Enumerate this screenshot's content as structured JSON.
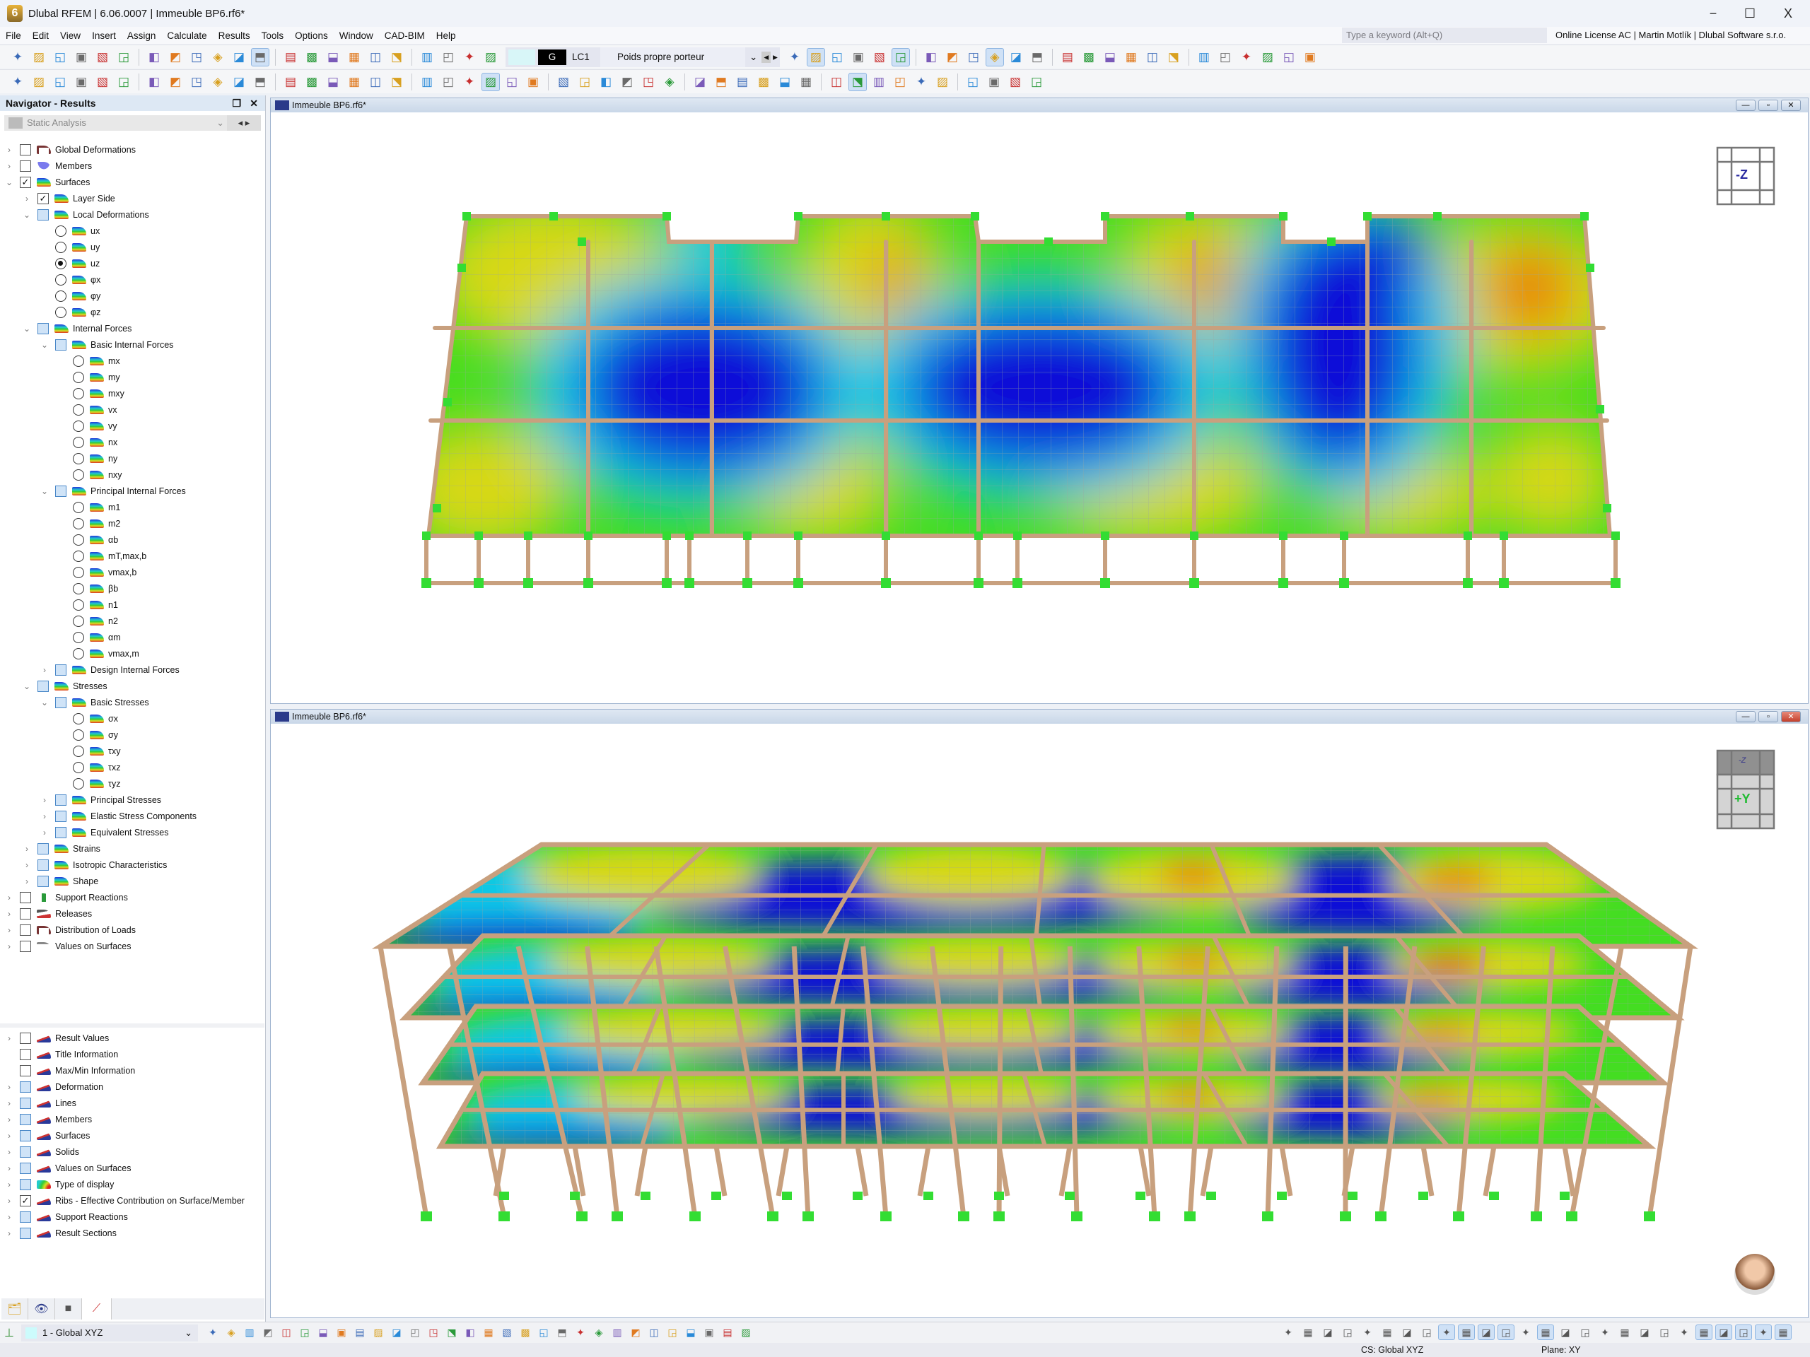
{
  "window": {
    "title": "Dlubal RFEM | 6.06.0007 | Immeuble BP6.rf6*",
    "minimize": "−",
    "maximize": "☐",
    "close": "X"
  },
  "menu": [
    "File",
    "Edit",
    "View",
    "Insert",
    "Assign",
    "Calculate",
    "Results",
    "Tools",
    "Options",
    "Window",
    "CAD-BIM",
    "Help"
  ],
  "search": {
    "placeholder": "Type a keyword (Alt+Q)"
  },
  "license": "Online License AC | Martin Motlík | Dlubal Software s.r.o.",
  "load_case": {
    "badge": "G",
    "id": "LC1",
    "name": "Poids propre porteur"
  },
  "toolbar1": [
    "new-model-icon",
    "open-icon",
    "dlubal-center-icon",
    "webservice-icon",
    "model-data-icon",
    "save-icon",
    "print-icon",
    "report-icon",
    "page-icon",
    "undo-icon",
    "redo-icon",
    "table-icon",
    "grid-table-icon",
    "color-table-icon",
    "console-icon",
    "script-icon",
    "list-icon",
    "help-icon",
    "section-icon",
    "calculator-icon",
    "load-down-icon",
    "load-down2-icon"
  ],
  "toolbar1b": [
    "filter-x-icon",
    "show-results-icon",
    "result-values-icon",
    "opacity-icon",
    "grid-results-icon",
    "results-eye-icon",
    "xxx-values-icon",
    "graph-icon",
    "numbering-icon",
    "render-x-icon",
    "box-icon",
    "box-edit-icon",
    "box-active-icon",
    "axis-x-icon",
    "axis-y-icon",
    "axis-z-icon",
    "axis-minus-x-icon",
    "microscope-icon",
    "section-cut-icon",
    "plane-icon",
    "dimension-icon",
    "column-icon",
    "cube-red-icon",
    "panel-orange-icon"
  ],
  "toolbar2": [
    "new-node-icon",
    "new-line-icon",
    "new-member-icon",
    "new-polyline-icon",
    "new-support-icon",
    "hinge-icon",
    "mesh-support-icon",
    "new-surface-icon",
    "new-solid-icon",
    "new-opening-icon",
    "new-solid2-icon",
    "new-box-icon",
    "axis-icon",
    "load-node-icon",
    "load-member-icon",
    "load-surface-icon",
    "load-solid-icon",
    "load-free-icon",
    "load-wizard-icon",
    "filter-icon",
    "chart-icon",
    "frame-icon",
    "film-icon",
    "diagram-icon",
    "iso-surface-icon",
    "solid-render-icon",
    "reaction-icon",
    "line-render-icon",
    "member-a-icon",
    "member-b-icon",
    "member-c-icon",
    "member-d-icon",
    "member-e-icon",
    "member-f-icon",
    "color-pen-icon",
    "color-scale-icon",
    "grid-view-icon",
    "node-grid-icon",
    "cut-plane-icon",
    "cut-plane2-icon",
    "cut-plane3-icon",
    "link-icon",
    "rotate-icon",
    "mirror-icon",
    "delete-x-icon",
    "settings-icon"
  ],
  "navigator": {
    "title": "Navigator - Results",
    "combo": "Static Analysis",
    "tree": [
      {
        "label": "Global Deformations",
        "d": 0,
        "t": "cb",
        "s": "off",
        "e": ">",
        "i": "frame-deform-icon"
      },
      {
        "label": "Members",
        "d": 0,
        "t": "cb",
        "s": "off",
        "e": ">",
        "i": "member-diagram-icon"
      },
      {
        "label": "Surfaces",
        "d": 0,
        "t": "cb",
        "s": "on",
        "e": "v",
        "i": "surface-results-icon"
      },
      {
        "label": "Layer Side",
        "d": 1,
        "t": "cb",
        "s": "on",
        "e": ">",
        "i": "surface-results-icon"
      },
      {
        "label": "Local Deformations",
        "d": 1,
        "t": "cb",
        "s": "partial",
        "e": "v",
        "i": "surface-results-icon"
      },
      {
        "label": "ux",
        "d": 2,
        "t": "rb",
        "s": "off",
        "i": "surface-results-icon"
      },
      {
        "label": "uy",
        "d": 2,
        "t": "rb",
        "s": "off",
        "i": "surface-results-icon"
      },
      {
        "label": "uz",
        "d": 2,
        "t": "rb",
        "s": "on",
        "i": "surface-results-icon"
      },
      {
        "label": "φx",
        "d": 2,
        "t": "rb",
        "s": "off",
        "i": "surface-results-icon"
      },
      {
        "label": "φy",
        "d": 2,
        "t": "rb",
        "s": "off",
        "i": "surface-results-icon"
      },
      {
        "label": "φz",
        "d": 2,
        "t": "rb",
        "s": "off",
        "i": "surface-results-icon"
      },
      {
        "label": "Internal Forces",
        "d": 1,
        "t": "cb",
        "s": "partial",
        "e": "v",
        "i": "surface-results-icon"
      },
      {
        "label": "Basic Internal Forces",
        "d": 2,
        "t": "cb",
        "s": "partial",
        "e": "v",
        "i": "surface-results-icon"
      },
      {
        "label": "mx",
        "d": 3,
        "t": "rb",
        "s": "off",
        "i": "surface-results-icon"
      },
      {
        "label": "my",
        "d": 3,
        "t": "rb",
        "s": "off",
        "i": "surface-results-icon"
      },
      {
        "label": "mxy",
        "d": 3,
        "t": "rb",
        "s": "off",
        "i": "surface-results-icon"
      },
      {
        "label": "vx",
        "d": 3,
        "t": "rb",
        "s": "off",
        "i": "surface-results-icon"
      },
      {
        "label": "vy",
        "d": 3,
        "t": "rb",
        "s": "off",
        "i": "surface-results-icon"
      },
      {
        "label": "nx",
        "d": 3,
        "t": "rb",
        "s": "off",
        "i": "surface-results-icon"
      },
      {
        "label": "ny",
        "d": 3,
        "t": "rb",
        "s": "off",
        "i": "surface-results-icon"
      },
      {
        "label": "nxy",
        "d": 3,
        "t": "rb",
        "s": "off",
        "i": "surface-results-icon"
      },
      {
        "label": "Principal Internal Forces",
        "d": 2,
        "t": "cb",
        "s": "partial",
        "e": "v",
        "i": "surface-results-icon"
      },
      {
        "label": "m1",
        "d": 3,
        "t": "rb",
        "s": "off",
        "i": "surface-results-icon"
      },
      {
        "label": "m2",
        "d": 3,
        "t": "rb",
        "s": "off",
        "i": "surface-results-icon"
      },
      {
        "label": "αb",
        "d": 3,
        "t": "rb",
        "s": "off",
        "i": "surface-results-icon"
      },
      {
        "label": "mT,max,b",
        "d": 3,
        "t": "rb",
        "s": "off",
        "i": "surface-results-icon"
      },
      {
        "label": "vmax,b",
        "d": 3,
        "t": "rb",
        "s": "off",
        "i": "surface-results-icon"
      },
      {
        "label": "βb",
        "d": 3,
        "t": "rb",
        "s": "off",
        "i": "surface-results-icon"
      },
      {
        "label": "n1",
        "d": 3,
        "t": "rb",
        "s": "off",
        "i": "surface-results-icon"
      },
      {
        "label": "n2",
        "d": 3,
        "t": "rb",
        "s": "off",
        "i": "surface-results-icon"
      },
      {
        "label": "αm",
        "d": 3,
        "t": "rb",
        "s": "off",
        "i": "surface-results-icon"
      },
      {
        "label": "vmax,m",
        "d": 3,
        "t": "rb",
        "s": "off",
        "i": "surface-results-icon"
      },
      {
        "label": "Design Internal Forces",
        "d": 2,
        "t": "cb",
        "s": "partial",
        "e": ">",
        "i": "surface-results-icon"
      },
      {
        "label": "Stresses",
        "d": 1,
        "t": "cb",
        "s": "partial",
        "e": "v",
        "i": "surface-results-icon"
      },
      {
        "label": "Basic Stresses",
        "d": 2,
        "t": "cb",
        "s": "partial",
        "e": "v",
        "i": "surface-results-icon"
      },
      {
        "label": "σx",
        "d": 3,
        "t": "rb",
        "s": "off",
        "i": "surface-results-icon"
      },
      {
        "label": "σy",
        "d": 3,
        "t": "rb",
        "s": "off",
        "i": "surface-results-icon"
      },
      {
        "label": "τxy",
        "d": 3,
        "t": "rb",
        "s": "off",
        "i": "surface-results-icon"
      },
      {
        "label": "τxz",
        "d": 3,
        "t": "rb",
        "s": "off",
        "i": "surface-results-icon"
      },
      {
        "label": "τyz",
        "d": 3,
        "t": "rb",
        "s": "off",
        "i": "surface-results-icon"
      },
      {
        "label": "Principal Stresses",
        "d": 2,
        "t": "cb",
        "s": "partial",
        "e": ">",
        "i": "surface-results-icon"
      },
      {
        "label": "Elastic Stress Components",
        "d": 2,
        "t": "cb",
        "s": "partial",
        "e": ">",
        "i": "surface-results-icon"
      },
      {
        "label": "Equivalent Stresses",
        "d": 2,
        "t": "cb",
        "s": "partial",
        "e": ">",
        "i": "surface-results-icon"
      },
      {
        "label": "Strains",
        "d": 1,
        "t": "cb",
        "s": "partial",
        "e": ">",
        "i": "surface-results-icon"
      },
      {
        "label": "Isotropic Characteristics",
        "d": 1,
        "t": "cb",
        "s": "partial",
        "e": ">",
        "i": "surface-results-icon"
      },
      {
        "label": "Shape",
        "d": 1,
        "t": "cb",
        "s": "partial",
        "e": ">",
        "i": "surface-results-icon"
      },
      {
        "label": "Support Reactions",
        "d": 0,
        "t": "cb",
        "s": "off",
        "e": ">",
        "i": "support-reaction-icon"
      },
      {
        "label": "Releases",
        "d": 0,
        "t": "cb",
        "s": "off",
        "e": ">",
        "i": "release-icon"
      },
      {
        "label": "Distribution of Loads",
        "d": 0,
        "t": "cb",
        "s": "off",
        "e": ">",
        "i": "load-distribution-icon"
      },
      {
        "label": "Values on Surfaces",
        "d": 0,
        "t": "cb",
        "s": "off",
        "e": ">",
        "i": "values-surface-icon"
      }
    ],
    "display_tree": [
      {
        "label": "Result Values",
        "d": 0,
        "t": "cb",
        "s": "off",
        "e": ">",
        "i": "result-values-icon"
      },
      {
        "label": "Title Information",
        "d": 0,
        "t": "cb",
        "s": "off",
        "e": "",
        "i": "display-eye-icon"
      },
      {
        "label": "Max/Min Information",
        "d": 0,
        "t": "cb",
        "s": "off",
        "e": "",
        "i": "display-eye-icon"
      },
      {
        "label": "Deformation",
        "d": 0,
        "t": "cb",
        "s": "partial",
        "e": ">",
        "i": "display-eye-icon"
      },
      {
        "label": "Lines",
        "d": 0,
        "t": "cb",
        "s": "partial",
        "e": ">",
        "i": "display-eye-icon"
      },
      {
        "label": "Members",
        "d": 0,
        "t": "cb",
        "s": "partial",
        "e": ">",
        "i": "display-eye-icon"
      },
      {
        "label": "Surfaces",
        "d": 0,
        "t": "cb",
        "s": "partial",
        "e": ">",
        "i": "display-eye-icon"
      },
      {
        "label": "Solids",
        "d": 0,
        "t": "cb",
        "s": "partial",
        "e": ">",
        "i": "display-eye-icon"
      },
      {
        "label": "Values on Surfaces",
        "d": 0,
        "t": "cb",
        "s": "partial",
        "e": ">",
        "i": "display-eye-icon"
      },
      {
        "label": "Type of display",
        "d": 0,
        "t": "cb",
        "s": "partial",
        "e": ">",
        "i": "color-contour-icon"
      },
      {
        "label": "Ribs - Effective Contribution on Surface/Member",
        "d": 0,
        "t": "cb",
        "s": "on",
        "e": ">",
        "i": "display-eye-icon"
      },
      {
        "label": "Support Reactions",
        "d": 0,
        "t": "cb",
        "s": "partial",
        "e": ">",
        "i": "display-eye-icon"
      },
      {
        "label": "Result Sections",
        "d": 0,
        "t": "cb",
        "s": "partial",
        "e": ">",
        "i": "display-eye-icon"
      }
    ],
    "tabs": [
      "data-tab-icon",
      "view-tab-icon",
      "camera-tab-icon",
      "results-tab-icon"
    ]
  },
  "coordinate_system": "1 - Global XYZ",
  "viewports": [
    {
      "title": "Immeuble BP6.rf6*",
      "view_cube": "-Z"
    },
    {
      "title": "Immeuble BP6.rf6*",
      "view_cube": "+Y",
      "view_cube_top": "-Z"
    }
  ],
  "status": {
    "cs": "CS: Global XYZ",
    "plane": "Plane: XY"
  },
  "colors": {
    "beam": "#c8a07e",
    "support": "#33dd33",
    "blue": "#1010d8",
    "cyan": "#10c8e8",
    "green": "#44dd22",
    "yellow": "#d8d818",
    "orange": "#e87810",
    "red": "#d81010"
  }
}
